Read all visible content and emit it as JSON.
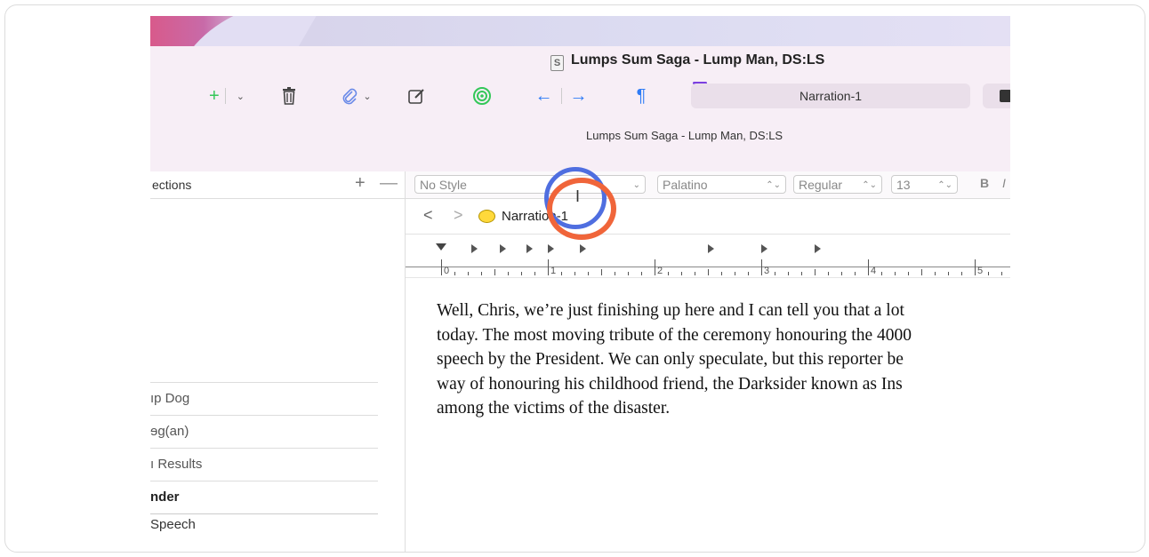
{
  "window": {
    "title": "Lumps Sum Saga - Lump Man, DS:LS",
    "doc_icon": "S",
    "subtitle": "Lumps Sum Saga - Lump Man, DS:LS"
  },
  "toolbar": {
    "add_icon": "+",
    "caret": "⌄",
    "trash_icon": "🗑",
    "attach_icon": "📎",
    "compose_icon": "✎",
    "target_icon": "◎",
    "back_arrow": "←",
    "forward_arrow": "→",
    "pilcrow": "¶",
    "document_field": "Narration-1"
  },
  "sidebar": {
    "title": "ections",
    "add": "+",
    "remove": "—",
    "items": [
      {
        "label": "ıp Dog"
      },
      {
        "label": "ɘg(an)"
      },
      {
        "label": "ı Results"
      },
      {
        "label": "nder"
      },
      {
        "label": "Speech"
      }
    ]
  },
  "format": {
    "style": "No Style",
    "font": "Palatino",
    "weight": "Regular",
    "size": "13",
    "bold": "B",
    "italic": "I"
  },
  "nav": {
    "back": "<",
    "forward": ">",
    "doc_title": "Narration-1"
  },
  "ruler": {
    "numbers": [
      "0",
      "1",
      "2",
      "3",
      "4",
      "5"
    ]
  },
  "body": {
    "lines": [
      "Well, Chris, we’re just finishing up here and I can tell you that a lot",
      "today. The most moving tribute of the ceremony honouring the 4000",
      "speech by the President. We can only speculate, but this reporter be",
      "way of honouring his childhood friend, the Darksider known as Ins",
      "among the victims of the disaster."
    ]
  },
  "colors": {
    "accent_green": "#34c759",
    "accent_blue": "#2f7cf6",
    "highlight_red": "#f0653a",
    "highlight_blue": "#4f6ee0"
  }
}
